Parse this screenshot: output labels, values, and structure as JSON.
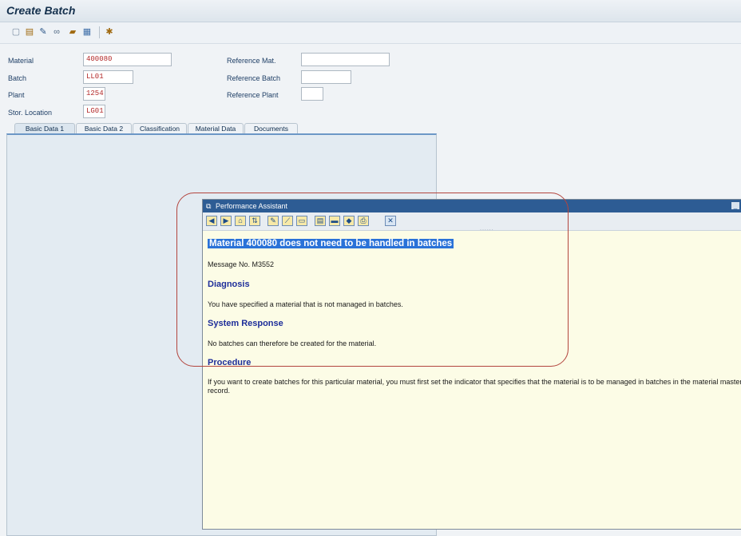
{
  "window": {
    "title": "Create Batch"
  },
  "toolbar": {
    "icons": [
      "new-document-icon",
      "other-object-icon",
      "edit-pencil-icon",
      "display-glasses-icon",
      "folder-icon",
      "save-layout-icon",
      "help-icon"
    ]
  },
  "form": {
    "material": {
      "label": "Material",
      "value": "400080"
    },
    "batch": {
      "label": "Batch",
      "value": "LL01"
    },
    "plant": {
      "label": "Plant",
      "value": "1254"
    },
    "stor_location": {
      "label": "Stor. Location",
      "value": "LG01"
    },
    "ref_material": {
      "label": "Reference Mat.",
      "value": ""
    },
    "ref_batch": {
      "label": "Reference Batch",
      "value": ""
    },
    "ref_plant": {
      "label": "Reference Plant",
      "value": ""
    }
  },
  "tabs": [
    {
      "label": "Basic Data 1",
      "active": true
    },
    {
      "label": "Basic Data 2",
      "active": false
    },
    {
      "label": "Classification",
      "active": false
    },
    {
      "label": "Material Data",
      "active": false
    },
    {
      "label": "Documents",
      "active": false
    }
  ],
  "assistant": {
    "title": "Performance Assistant",
    "minimize": "_",
    "dots": "......",
    "heading": "Material 400080 does not need to be handled in batches",
    "message_no": "Message No. M3552",
    "diagnosis_title": "Diagnosis",
    "diagnosis_text": "You have specified a material that is not managed in batches.",
    "response_title": "System Response",
    "response_text": "No batches can therefore be created for the material.",
    "procedure_title": "Procedure",
    "procedure_text": "If you want to create batches for this particular material, you must first set the indicator that specifies that the material is to be managed in batches in the material master record."
  },
  "colors": {
    "highlight": "#b3453e",
    "assistant_title_bar": "#2d5c94",
    "field_text": "#b32a2a"
  }
}
